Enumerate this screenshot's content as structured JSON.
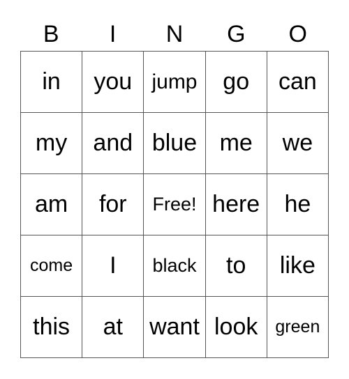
{
  "header": [
    "B",
    "I",
    "N",
    "G",
    "O"
  ],
  "rows": [
    [
      "in",
      "you",
      "jump",
      "go",
      "can"
    ],
    [
      "my",
      "and",
      "blue",
      "me",
      "we"
    ],
    [
      "am",
      "for",
      "Free!",
      "here",
      "he"
    ],
    [
      "come",
      "I",
      "black",
      "to",
      "like"
    ],
    [
      "this",
      "at",
      "want",
      "look",
      "green"
    ]
  ]
}
